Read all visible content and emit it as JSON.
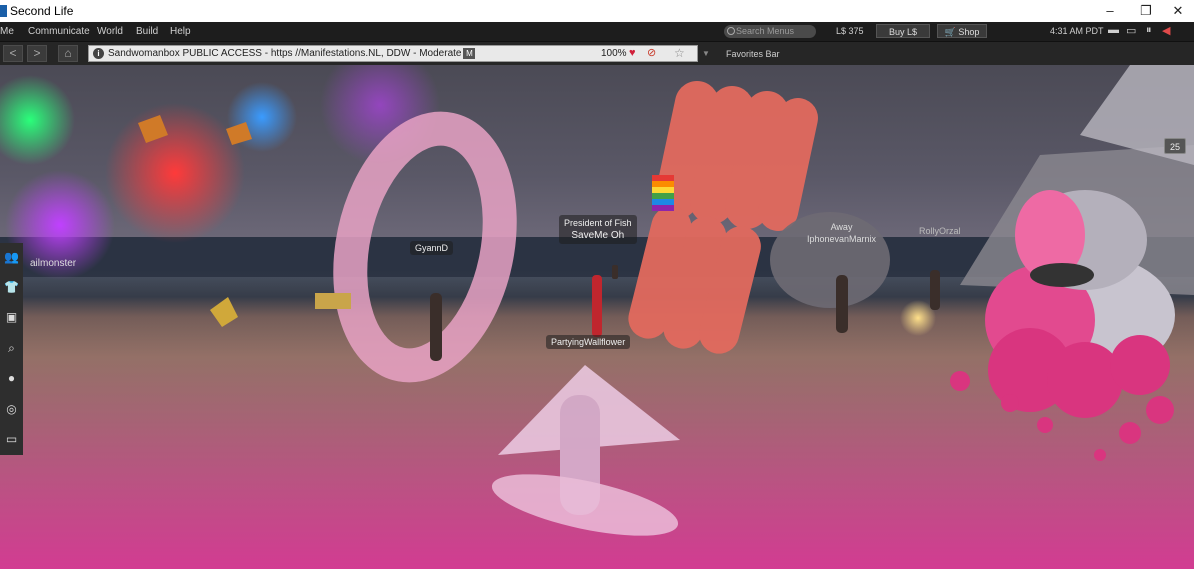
{
  "window": {
    "title": "Second Life",
    "controls": {
      "minimize": "–",
      "maximize": "❐",
      "close": "✕"
    }
  },
  "menu": {
    "items": [
      "Me",
      "Communicate",
      "World",
      "Build",
      "Help"
    ],
    "search_placeholder": "Search Menus",
    "balance": "L$ 375",
    "buy_label": "Buy L$",
    "shop_label": "Shop",
    "time": "4:31 AM PDT"
  },
  "nav": {
    "back": "<",
    "forward": ">",
    "home": "⌂",
    "location": "Sandwomanbox PUBLIC ACCESS - https //Manifestations.NL, DDW - Moderate",
    "maturity_badge": "M",
    "zoom": "100%",
    "favorites_label": "Favorites Bar"
  },
  "scene": {
    "name_tags": {
      "ailmonster": "ailmonster",
      "gyann": "GyannD",
      "president_title": "President of Fish",
      "president_name": "SaveMe Oh",
      "partying": "PartyingWallflower",
      "away_status": "Away",
      "away_name": "IphonevanMarnix",
      "rolly": "RollyOrzal"
    },
    "corner_badge": "25"
  },
  "sidebar_icons": [
    "people-icon",
    "appearance-icon",
    "inventory-icon",
    "search-icon",
    "avatar-icon",
    "voice-icon",
    "snapshot-icon"
  ],
  "colors": {
    "menu_bg": "#1d1d1d",
    "accent_pink": "#c64e8c",
    "heart": "#d0203a"
  }
}
